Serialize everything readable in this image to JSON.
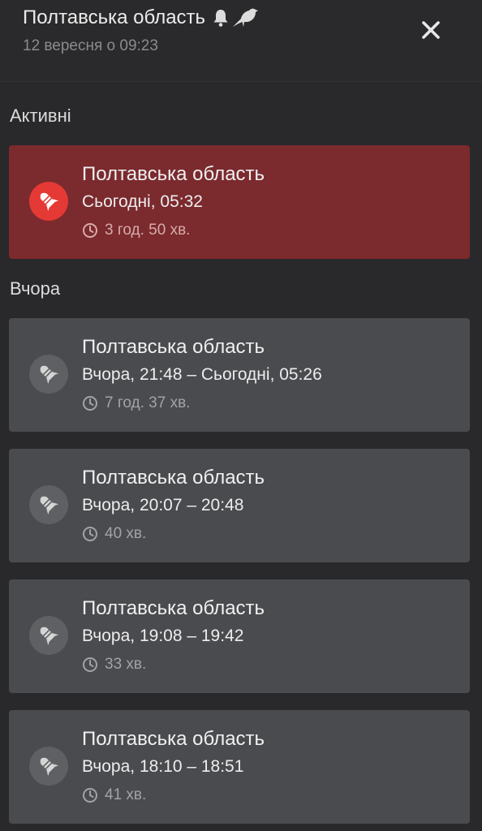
{
  "header": {
    "title": "Полтавська область",
    "subtitle": "12 вересня о 09:23",
    "icons": [
      "bell-icon",
      "bird-icon"
    ],
    "close_icon": "close-icon"
  },
  "sections": {
    "active_label": "Активні",
    "yesterday_label": "Вчора"
  },
  "active_alert": {
    "region": "Полтавська область",
    "time": "Сьогодні, 05:32",
    "duration": "3 год. 50 хв.",
    "icon": "missile-icon"
  },
  "history": [
    {
      "region": "Полтавська область",
      "time": "Вчора, 21:48 – Сьогодні, 05:26",
      "duration": "7 год. 37 хв."
    },
    {
      "region": "Полтавська область",
      "time": "Вчора, 20:07 – 20:48",
      "duration": "40 хв."
    },
    {
      "region": "Полтавська область",
      "time": "Вчора, 19:08 – 19:42",
      "duration": "33 хв."
    },
    {
      "region": "Полтавська область",
      "time": "Вчора, 18:10 – 18:51",
      "duration": "41 хв."
    }
  ],
  "colors": {
    "background": "#29292b",
    "card": "#4a4b4e",
    "active_card": "#7b2a2e",
    "active_icon": "#e53935"
  }
}
